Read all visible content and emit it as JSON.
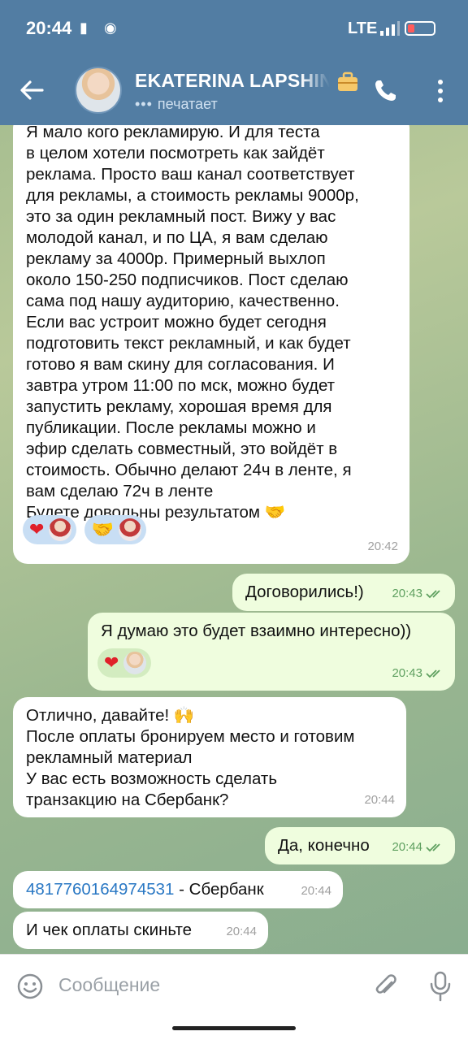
{
  "status_bar": {
    "time": "20:44",
    "network": "LTE"
  },
  "header": {
    "contact_name": "EKATERINA LAPSHINA",
    "status_dots": "•••",
    "status_text": "печатает"
  },
  "messages": [
    {
      "direction": "in",
      "text": "Я мало кого рекламирую. И для теста\nв целом хотели посмотреть как зайдёт\nреклама. Просто ваш канал соответствует\nдля рекламы, а стоимость рекламы 9000р,\nэто за один рекламный пост. Вижу у вас\nмолодой канал, и по ЦА, я вам сделаю\nрекламу за 4000р. Примерный выхлоп\nоколо 150-250 подписчиков. Пост сделаю\nсама под нашу аудиторию, качественно.\nЕсли вас устроит можно будет сегодня\nподготовить текст рекламный, и как будет\nготово я вам скину для согласования. И\nзавтра утром 11:00 по мск, можно будет\nзапустить рекламу, хорошая время для\nпубликации. После рекламы можно и\nэфир сделать совместный, это войдёт в\nстоимость. Обычно делают 24ч в ленте, я\nвам сделаю 72ч в ленте\nБудете довольны результатом 🤝",
      "reactions": [
        "❤",
        "🤝"
      ],
      "time": "20:42"
    },
    {
      "direction": "out",
      "text": "Договорились!)",
      "time": "20:43"
    },
    {
      "direction": "out",
      "text": "Я думаю это будет взаимно интересно))",
      "reactions": [
        "❤"
      ],
      "time": "20:43"
    },
    {
      "direction": "in",
      "text": "Отлично, давайте! 🙌\nПосле оплаты бронируем место и готовим\nрекламный материал\nУ вас есть возможность сделать\nтранзакцию на Сбербанк?",
      "time": "20:44"
    },
    {
      "direction": "out",
      "text": "Да, конечно",
      "time": "20:44"
    },
    {
      "direction": "in",
      "link_text": "4817760164974531",
      "text": " - Сбербанк",
      "time": "20:44"
    },
    {
      "direction": "in",
      "text": "И чек оплаты скиньте",
      "time": "20:44"
    }
  ],
  "input": {
    "placeholder": "Сообщение"
  },
  "colors": {
    "header": "#527da3",
    "outgoing_bubble": "#effdde",
    "incoming_bubble": "#ffffff",
    "link": "#2a78c4"
  },
  "icons": [
    "back-arrow-icon",
    "briefcase-icon",
    "phone-icon",
    "more-vertical-icon",
    "emoji-icon",
    "attach-icon",
    "mic-icon"
  ]
}
